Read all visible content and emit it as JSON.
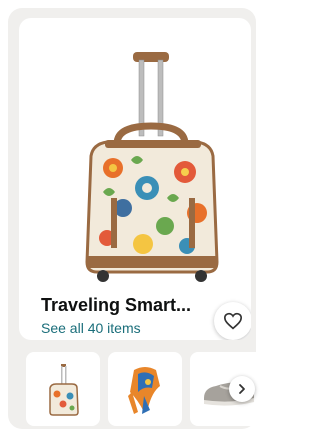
{
  "product": {
    "title": "Traveling Smart...",
    "see_all_label": "See all 40 items"
  },
  "icons": {
    "favorite": "heart-icon",
    "next": "chevron-right-icon"
  },
  "thumbnails": [
    {
      "name": "rolling-floral-bag"
    },
    {
      "name": "orange-blue-scarf"
    },
    {
      "name": "gray-slip-on-shoe"
    }
  ],
  "colors": {
    "card_bg": "#f0efed",
    "link": "#1a6e7a",
    "title": "#0f1111"
  }
}
